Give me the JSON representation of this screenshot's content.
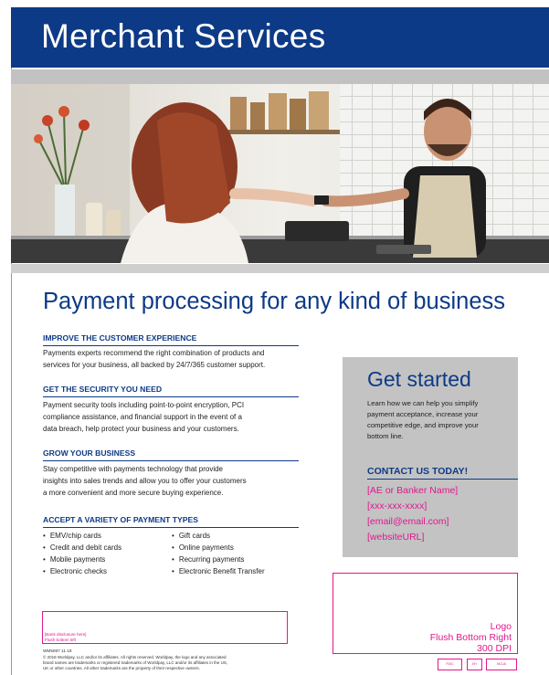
{
  "header": {
    "title": "Merchant Services"
  },
  "hero": {
    "alt": ""
  },
  "headline": "Payment processing for any kind of business",
  "sections": [
    {
      "heading": "IMPROVE THE CUSTOMER EXPERIENCE",
      "lines": [
        "Payments experts recommend the right combination of products and",
        "services for your business, all backed by 24/7/365 customer support."
      ]
    },
    {
      "heading": "GET THE SECURITY YOU NEED",
      "lines": [
        "Payment security tools including point-to-point encryption, PCI",
        "compliance assistance, and financial support in the event of a",
        "data breach, help protect your business and your customers."
      ]
    },
    {
      "heading": "GROW YOUR BUSINESS",
      "lines": [
        "Stay competitive with payments technology that provide",
        "insights into sales trends and allow you to offer your customers",
        "a more convenient and more secure buying experience."
      ]
    },
    {
      "heading": "ACCEPT A VARIETY OF PAYMENT TYPES",
      "lines": []
    }
  ],
  "payment_types": {
    "left": [
      "EMV/chip cards",
      "Credit and debit cards",
      "Mobile payments",
      "Electronic checks"
    ],
    "right": [
      "Gift cards",
      "Online payments",
      "Recurring payments",
      "Electronic Benefit Transfer"
    ]
  },
  "get_started": {
    "title": "Get started",
    "text_lines": [
      "Learn how we can help you simplify",
      "payment acceptance, increase your",
      "competitive edge, and improve your",
      "bottom line."
    ],
    "contact_heading": "CONTACT US TODAY!",
    "contacts": [
      "[AE or Banker Name]",
      "[xxx-xxx-xxxx]",
      "[email@email.com]",
      "[websiteURL]"
    ]
  },
  "logo_box": {
    "lines": [
      "Logo",
      "Flush Bottom Right",
      "300 DPI"
    ]
  },
  "disclosure": {
    "lines": [
      "[Bank disclosure here]",
      "Flush bottom left"
    ]
  },
  "footer": {
    "code": "WM5087 11.18",
    "legal_lines": [
      "© 2018 Worldpay, LLC and/or its affiliates.  All rights reserved.  Worldpay, the logo and any associated",
      "brand names are trademarks or registered trademarks of Worldpay, LLC and/or its affiliates in the US,",
      "UK or other countries. All other trademarks are the property of their respective owners."
    ]
  },
  "badges": [
    "FDIC",
    "EH",
    "NCUA"
  ],
  "colors": {
    "brand_blue": "#0d3a86",
    "placeholder_magenta": "#e0188c",
    "panel_gray": "#c3c3c3"
  }
}
